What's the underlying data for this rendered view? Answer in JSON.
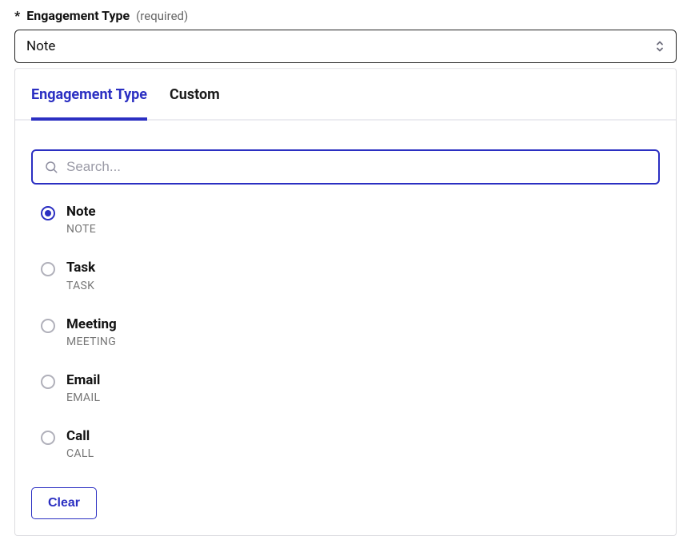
{
  "field": {
    "asterisk": "*",
    "label": "Engagement Type",
    "required": "(required)"
  },
  "select": {
    "value": "Note"
  },
  "tabs": {
    "engagement": "Engagement Type",
    "custom": "Custom"
  },
  "search": {
    "placeholder": "Search..."
  },
  "options": [
    {
      "label": "Note",
      "code": "NOTE",
      "selected": true
    },
    {
      "label": "Task",
      "code": "TASK",
      "selected": false
    },
    {
      "label": "Meeting",
      "code": "MEETING",
      "selected": false
    },
    {
      "label": "Email",
      "code": "EMAIL",
      "selected": false
    },
    {
      "label": "Call",
      "code": "CALL",
      "selected": false
    }
  ],
  "clear": "Clear"
}
